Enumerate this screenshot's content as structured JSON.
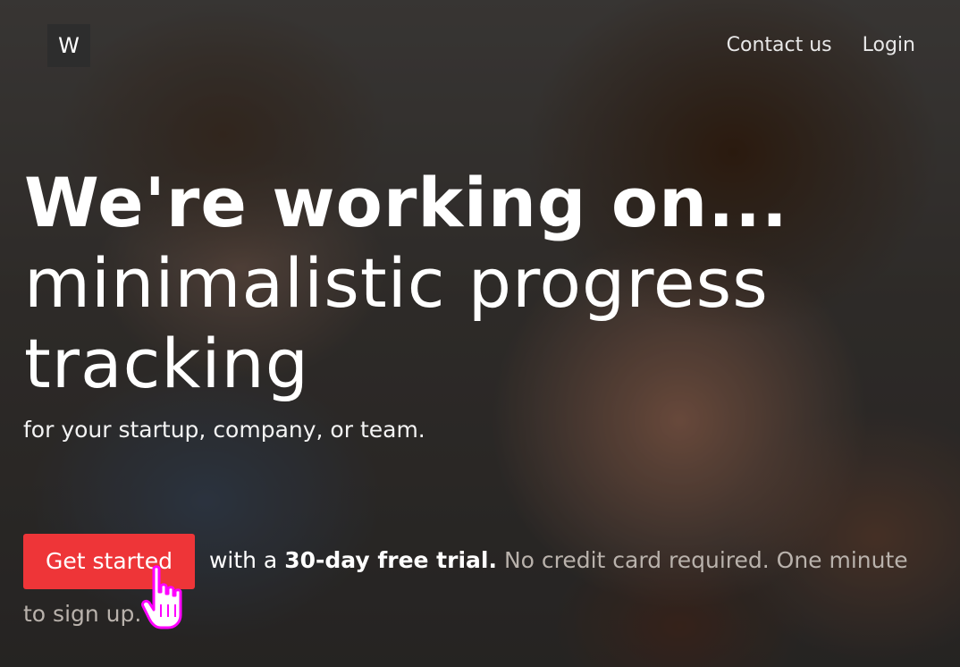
{
  "header": {
    "logo_text": "W",
    "nav": [
      {
        "label": "Contact us"
      },
      {
        "label": "Login"
      }
    ]
  },
  "hero": {
    "headline_bold": "We're working on...",
    "headline_line2": "minimalistic progress",
    "headline_line3": "tracking",
    "subheading": "for your startup, company, or team.",
    "cta_button": "Get started",
    "cta_with": "with a",
    "cta_strong": "30-day free trial.",
    "cta_note": "No credit card required. One minute to sign up."
  },
  "icons": {
    "cursor": "hand-pointer-icon"
  },
  "colors": {
    "accent": "#ee3538",
    "cursor": "#ff00ff",
    "logo_bg": "#2d2d2d"
  }
}
